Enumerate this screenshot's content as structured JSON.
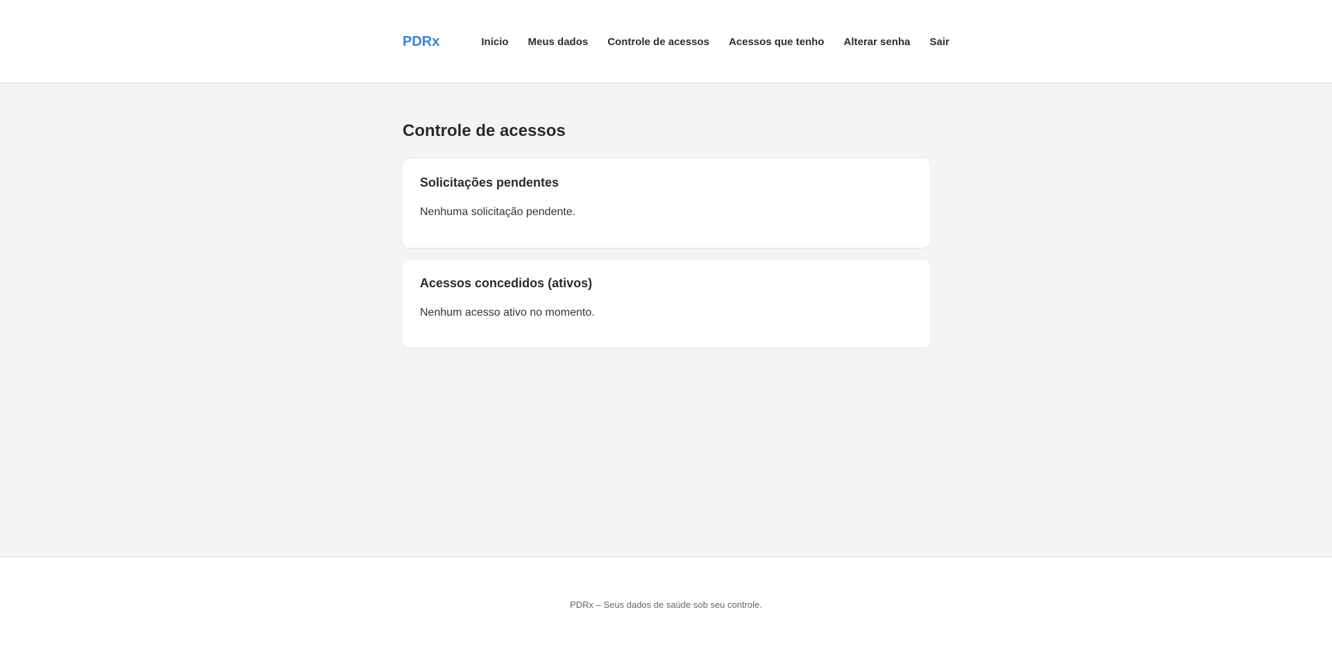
{
  "header": {
    "brand": "PDRx",
    "nav": {
      "inicio": "Início",
      "meus_dados": "Meus dados",
      "controle_acessos": "Controle de acessos",
      "acessos_que_tenho": "Acessos que tenho",
      "alterar_senha": "Alterar senha",
      "sair": "Sair"
    }
  },
  "main": {
    "title": "Controle de acessos",
    "pending": {
      "title": "Solicitações pendentes",
      "empty_text": "Nenhuma solicitação pendente."
    },
    "granted": {
      "title": "Acessos concedidos (ativos)",
      "empty_text": "Nenhum acesso ativo no momento."
    }
  },
  "footer": {
    "text": "PDRx – Seus dados de saúde sob seu controle."
  },
  "colors": {
    "brand": "#3b82d6",
    "background": "#f4f4f4",
    "surface": "#ffffff",
    "text": "#2a2a2a"
  }
}
